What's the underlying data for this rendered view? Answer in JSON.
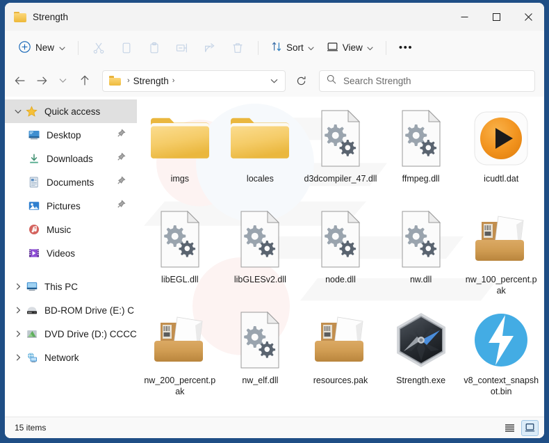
{
  "window": {
    "title": "Strength",
    "controls": {
      "minimize": "minimize-button",
      "maximize": "maximize-button",
      "close": "close-button"
    }
  },
  "toolbar": {
    "new_label": "New",
    "sort_label": "Sort",
    "view_label": "View",
    "more_label": "•••",
    "icons": [
      "cut-icon",
      "copy-icon",
      "paste-icon",
      "rename-icon",
      "share-icon",
      "delete-icon"
    ]
  },
  "address": {
    "back": "back-button",
    "forward": "forward-button",
    "recent": "recent-locations-button",
    "up": "up-button",
    "breadcrumb_root": "Strength",
    "separator": "›",
    "refresh": "refresh-button"
  },
  "search": {
    "placeholder": "Search Strength"
  },
  "sidebar": {
    "groups": [
      {
        "label": "Quick access",
        "icon": "star-icon",
        "expanded": true,
        "selected": true,
        "items": [
          {
            "label": "Desktop",
            "icon": "desktop-icon",
            "pinned": true
          },
          {
            "label": "Downloads",
            "icon": "downloads-icon",
            "pinned": true
          },
          {
            "label": "Documents",
            "icon": "documents-icon",
            "pinned": true
          },
          {
            "label": "Pictures",
            "icon": "pictures-icon",
            "pinned": true
          },
          {
            "label": "Music",
            "icon": "music-icon",
            "pinned": false
          },
          {
            "label": "Videos",
            "icon": "videos-icon",
            "pinned": false
          }
        ]
      }
    ],
    "roots": [
      {
        "label": "This PC",
        "icon": "this-pc-icon"
      },
      {
        "label": "BD-ROM Drive (E:) C",
        "icon": "bd-rom-drive-icon"
      },
      {
        "label": "DVD Drive (D:) CCCC",
        "icon": "dvd-drive-icon"
      },
      {
        "label": "Network",
        "icon": "network-icon"
      }
    ]
  },
  "files": [
    {
      "name": "imgs",
      "type": "folder"
    },
    {
      "name": "locales",
      "type": "folder"
    },
    {
      "name": "d3dcompiler_47.dll",
      "type": "dll"
    },
    {
      "name": "ffmpeg.dll",
      "type": "dll"
    },
    {
      "name": "icudtl.dat",
      "type": "media"
    },
    {
      "name": "libEGL.dll",
      "type": "dll"
    },
    {
      "name": "libGLESv2.dll",
      "type": "dll"
    },
    {
      "name": "node.dll",
      "type": "dll"
    },
    {
      "name": "nw.dll",
      "type": "dll"
    },
    {
      "name": "nw_100_percent.pak",
      "type": "pak"
    },
    {
      "name": "nw_200_percent.pak",
      "type": "pak"
    },
    {
      "name": "nw_elf.dll",
      "type": "dll"
    },
    {
      "name": "resources.pak",
      "type": "pak"
    },
    {
      "name": "Strength.exe",
      "type": "exe"
    },
    {
      "name": "v8_context_snapshot.bin",
      "type": "bin"
    }
  ],
  "status": {
    "item_count": "15 items",
    "list_view": "list-view-button",
    "details_view": "details-view-button"
  },
  "colors": {
    "window_border": "#1f4e85",
    "folder": "#edb838",
    "accent": "#0f62b5",
    "media_orange": "#f0951e",
    "bin_blue": "#3fa9e8",
    "selection": "#e0e0e0"
  }
}
